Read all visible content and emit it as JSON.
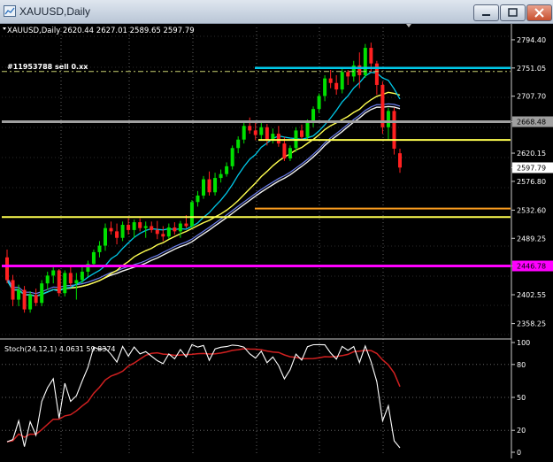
{
  "window": {
    "title": "XAUUSD,Daily",
    "buttons": [
      "minimize",
      "restore",
      "close"
    ]
  },
  "chart": {
    "info": "XAUUSD,Daily  2620.44 2627.01 2589.65 2597.79",
    "order_label": "#11953788 sell 0.xx",
    "price_labels": [
      "2794.40",
      "2751.05",
      "2707.70",
      "2668.48",
      "2620.15",
      "2597.79",
      "2576.80",
      "2532.60",
      "2489.25",
      "2446.78",
      "2402.55",
      "2358.25"
    ],
    "highlight_labels": {
      "gray": "2668.48",
      "current": "2597.79",
      "magenta": "2446.78"
    },
    "stoch_label": "Stoch(24,12,1) 4.0631 59.8374",
    "stoch_levels": [
      "100",
      "80",
      "50",
      "20",
      "0"
    ],
    "colors": {
      "background": "#000000",
      "bull": "#00e000",
      "bear": "#ff2020",
      "cyan_line": "#00c8e8",
      "yellow_line": "#ffff50",
      "orange_line": "#ffa020",
      "magenta_line": "#ff00ff",
      "gray_line": "#a0a0a0"
    }
  },
  "chart_data": {
    "type": "candlestick",
    "symbol": "XAUUSD",
    "timeframe": "Daily",
    "ohlc": [
      [
        2460,
        2472,
        2420,
        2425
      ],
      [
        2425,
        2433,
        2385,
        2395
      ],
      [
        2395,
        2418,
        2385,
        2410
      ],
      [
        2410,
        2416,
        2375,
        2380
      ],
      [
        2380,
        2408,
        2375,
        2402
      ],
      [
        2402,
        2412,
        2385,
        2390
      ],
      [
        2390,
        2425,
        2385,
        2420
      ],
      [
        2420,
        2438,
        2410,
        2432
      ],
      [
        2432,
        2446,
        2420,
        2440
      ],
      [
        2440,
        2442,
        2400,
        2405
      ],
      [
        2405,
        2440,
        2400,
        2436
      ],
      [
        2436,
        2446,
        2415,
        2420
      ],
      [
        2420,
        2436,
        2395,
        2425
      ],
      [
        2425,
        2445,
        2420,
        2438
      ],
      [
        2438,
        2455,
        2430,
        2450
      ],
      [
        2450,
        2472,
        2445,
        2468
      ],
      [
        2468,
        2485,
        2460,
        2478
      ],
      [
        2478,
        2512,
        2470,
        2505
      ],
      [
        2505,
        2515,
        2495,
        2500
      ],
      [
        2500,
        2512,
        2480,
        2490
      ],
      [
        2490,
        2515,
        2485,
        2510
      ],
      [
        2510,
        2520,
        2495,
        2502
      ],
      [
        2502,
        2518,
        2490,
        2514
      ],
      [
        2514,
        2520,
        2500,
        2505
      ],
      [
        2505,
        2515,
        2490,
        2508
      ],
      [
        2508,
        2515,
        2498,
        2502
      ],
      [
        2502,
        2516,
        2488,
        2496
      ],
      [
        2496,
        2508,
        2485,
        2492
      ],
      [
        2492,
        2512,
        2488,
        2506
      ],
      [
        2506,
        2514,
        2495,
        2500
      ],
      [
        2500,
        2516,
        2490,
        2512
      ],
      [
        2512,
        2525,
        2505,
        2508
      ],
      [
        2508,
        2548,
        2505,
        2545
      ],
      [
        2545,
        2562,
        2538,
        2555
      ],
      [
        2555,
        2585,
        2550,
        2580
      ],
      [
        2580,
        2592,
        2555,
        2560
      ],
      [
        2560,
        2590,
        2555,
        2582
      ],
      [
        2582,
        2595,
        2575,
        2588
      ],
      [
        2588,
        2606,
        2584,
        2600
      ],
      [
        2600,
        2632,
        2595,
        2628
      ],
      [
        2628,
        2646,
        2620,
        2641
      ],
      [
        2641,
        2670,
        2635,
        2662
      ],
      [
        2662,
        2675,
        2650,
        2655
      ],
      [
        2655,
        2668,
        2640,
        2648
      ],
      [
        2648,
        2670,
        2640,
        2660
      ],
      [
        2660,
        2665,
        2632,
        2640
      ],
      [
        2640,
        2658,
        2635,
        2650
      ],
      [
        2650,
        2662,
        2630,
        2635
      ],
      [
        2635,
        2645,
        2608,
        2612
      ],
      [
        2612,
        2632,
        2608,
        2628
      ],
      [
        2628,
        2660,
        2622,
        2655
      ],
      [
        2655,
        2664,
        2640,
        2645
      ],
      [
        2645,
        2672,
        2640,
        2668
      ],
      [
        2668,
        2692,
        2660,
        2688
      ],
      [
        2688,
        2712,
        2682,
        2708
      ],
      [
        2708,
        2740,
        2700,
        2735
      ],
      [
        2735,
        2748,
        2720,
        2728
      ],
      [
        2728,
        2740,
        2710,
        2718
      ],
      [
        2718,
        2752,
        2712,
        2745
      ],
      [
        2745,
        2748,
        2725,
        2738
      ],
      [
        2738,
        2762,
        2730,
        2755
      ],
      [
        2755,
        2775,
        2720,
        2740
      ],
      [
        2740,
        2788,
        2736,
        2782
      ],
      [
        2782,
        2790,
        2745,
        2758
      ],
      [
        2758,
        2762,
        2710,
        2725
      ],
      [
        2725,
        2730,
        2650,
        2660
      ],
      [
        2660,
        2690,
        2640,
        2685
      ],
      [
        2685,
        2690,
        2618,
        2627
      ],
      [
        2620,
        2627,
        2590,
        2598
      ]
    ],
    "horizontal_lines": [
      2751.05,
      2668.48,
      2640.5,
      2535.0,
      2522.0,
      2446.78
    ],
    "y_range": [
      2340,
      2812
    ],
    "stochastic": {
      "params": "24,12,1",
      "main": 4.0631,
      "signal": 59.8374,
      "levels": [
        80,
        50,
        20
      ]
    }
  }
}
